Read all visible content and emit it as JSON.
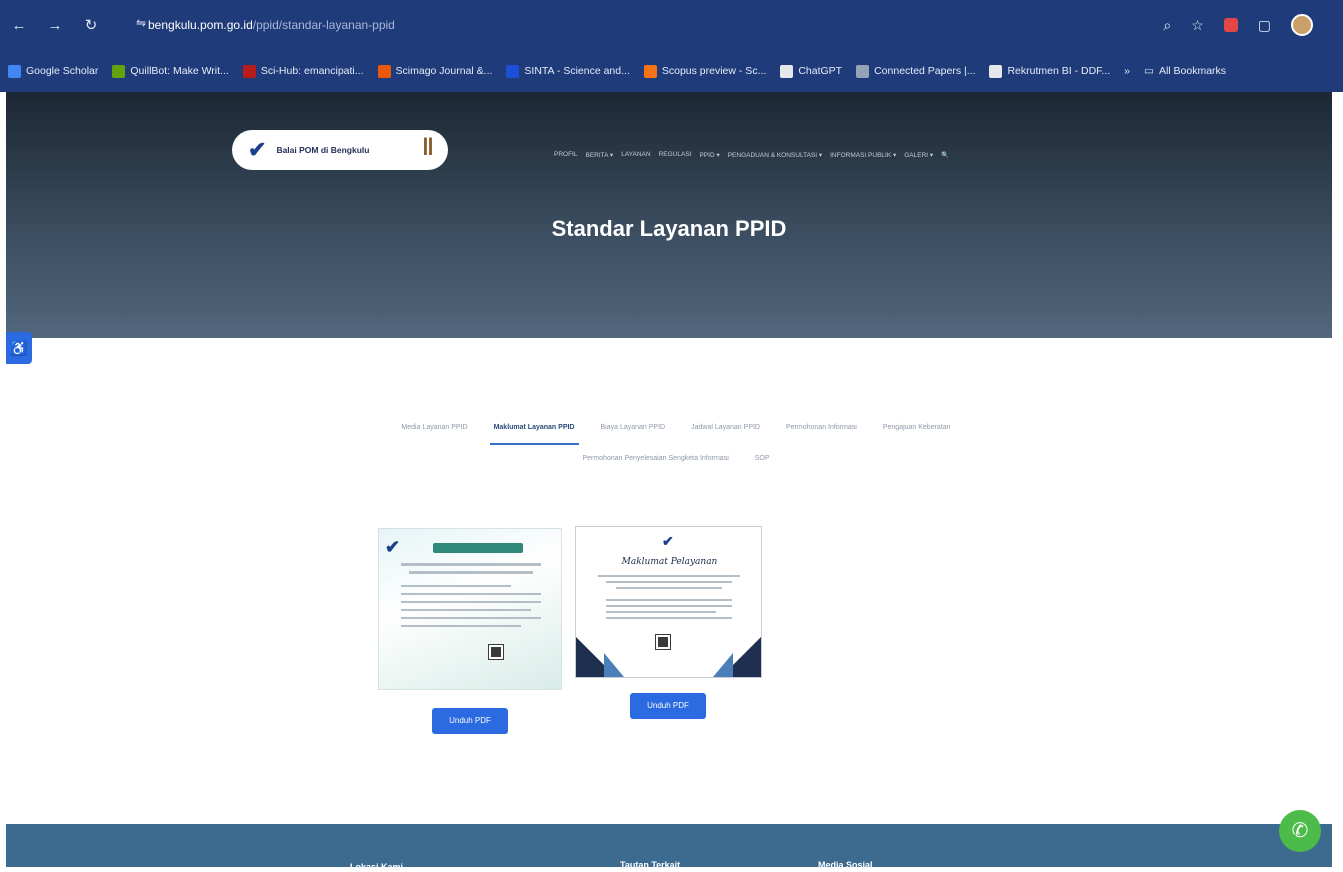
{
  "browser": {
    "back": "←",
    "forward": "→",
    "reload": "↻",
    "site_info": "⇋",
    "url_host": "bengkulu.pom.go.id",
    "url_path": "/ppid/standar-layanan-ppid",
    "bookmarks": [
      {
        "label": "Google Scholar",
        "color": "#4285f4"
      },
      {
        "label": "QuillBot: Make Writ...",
        "color": "#65a30d"
      },
      {
        "label": "Sci-Hub: emancipati...",
        "color": "#b91c1c"
      },
      {
        "label": "Scimago Journal &...",
        "color": "#ea580c"
      },
      {
        "label": "SINTA - Science and...",
        "color": "#1d4ed8"
      },
      {
        "label": "Scopus preview - Sc...",
        "color": "#f97316"
      },
      {
        "label": "ChatGPT",
        "color": "#e5e7eb"
      },
      {
        "label": "Connected Papers |...",
        "color": "#94a3b8"
      },
      {
        "label": "Rekrutmen BI - DDF...",
        "color": "#e5e7eb"
      }
    ],
    "more_bookmarks": "»",
    "all_bookmarks": "All Bookmarks"
  },
  "site": {
    "logo_text": "Balai POM di Bengkulu",
    "nav": [
      "PROFIL",
      "BERITA ▾",
      "LAYANAN",
      "REGULASI",
      "PPID ▾",
      "PENGADUAN & KONSULTASI ▾",
      "INFORMASI PUBLIK ▾",
      "GALERI ▾",
      "🔍"
    ],
    "page_title": "Standar Layanan PPID"
  },
  "tabs": {
    "row1": [
      "Media Layanan PPID",
      "Maklumat Layanan PPID",
      "Biaya Layanan PPID",
      "Jadwal Layanan PPID",
      "Permohonan Informasi",
      "Pengajuan Keberatan"
    ],
    "row2": [
      "Permohonan Penyelesaian Sengketa Informasi",
      "SOP"
    ],
    "active": "Maklumat Layanan PPID"
  },
  "documents": [
    {
      "download_label": "Unduh PDF"
    },
    {
      "download_label": "Unduh PDF",
      "heading": "Maklumat Pelayanan"
    }
  ],
  "footer": {
    "columns": [
      "Lokasi Kami",
      "Tautan Terkait",
      "Media Sosial"
    ]
  },
  "accessibility_icon": "♿",
  "whatsapp_icon": "✆"
}
